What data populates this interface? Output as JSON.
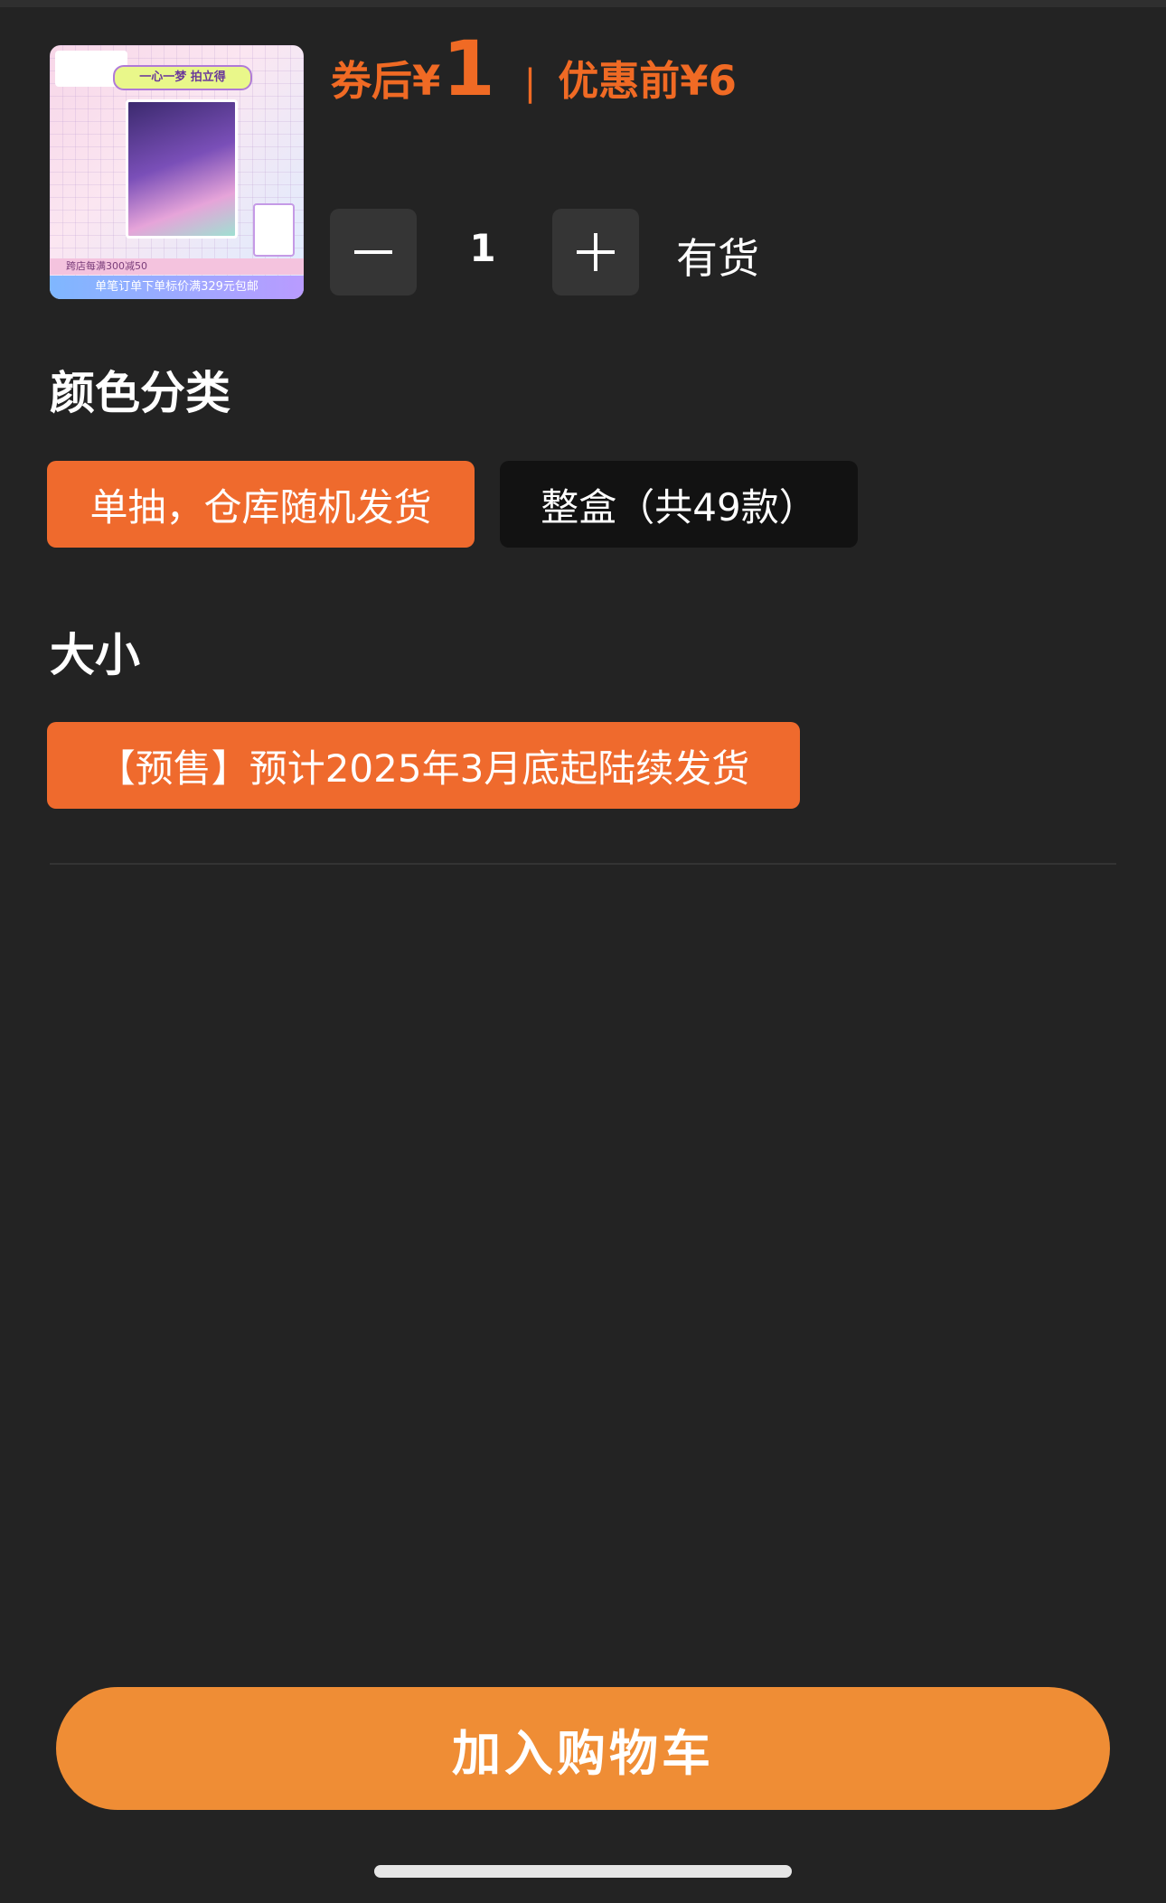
{
  "product": {
    "thumbnail": {
      "banner": "一心一梦 拍立得",
      "promo_line": "跨店每满300减50",
      "promo_bottom": "单笔订单下单标价满329元包邮"
    }
  },
  "price": {
    "after_coupon_label": "券后",
    "currency": "¥",
    "after_coupon_value": "1",
    "separator": "|",
    "before_discount_label": "优惠前",
    "before_discount_value": "6",
    "accent_color": "#f06a24"
  },
  "quantity": {
    "minus_icon": "minus-icon",
    "plus_icon": "plus-icon",
    "value": "1",
    "stock": "有货"
  },
  "color_section": {
    "title": "颜色分类",
    "options": [
      {
        "label": "单抽，仓库随机发货",
        "selected": true
      },
      {
        "label": "整盒（共49款）",
        "selected": false
      }
    ]
  },
  "size_section": {
    "title": "大小",
    "options": [
      {
        "label": "【预售】预计2025年3月底起陆续发货",
        "selected": true
      }
    ]
  },
  "actions": {
    "add_to_cart": "加入购物车",
    "button_color": "#ef8d35"
  }
}
